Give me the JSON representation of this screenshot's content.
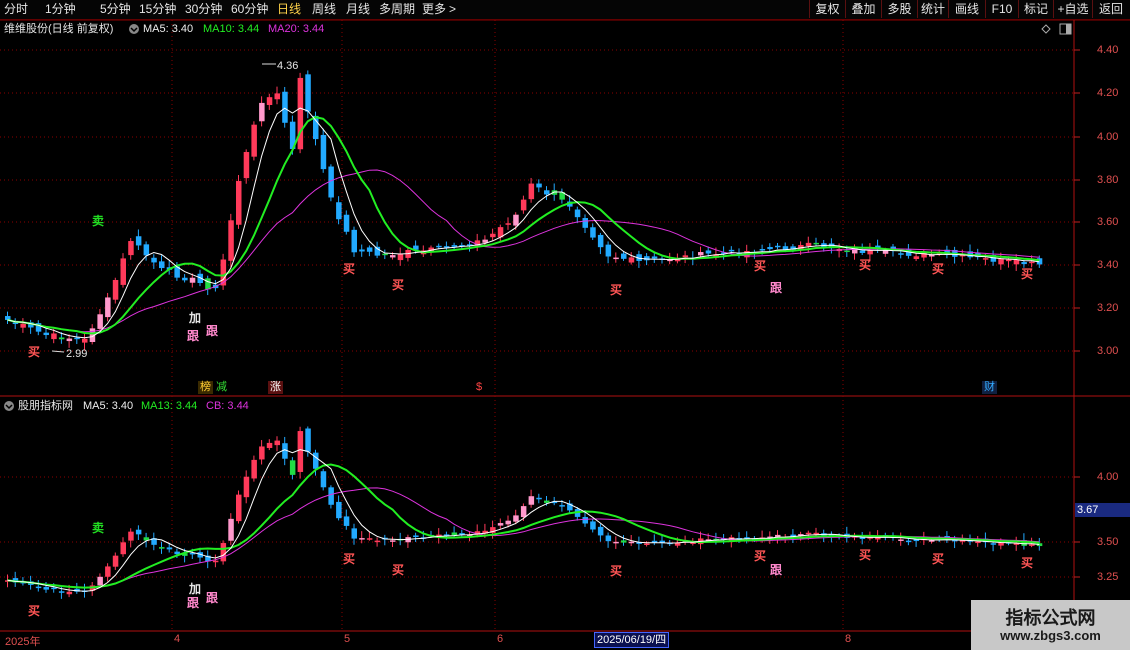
{
  "toolbar": {
    "timeframes": [
      "分时",
      "1分钟",
      "5分钟",
      "15分钟",
      "30分钟",
      "60分钟",
      "日线",
      "周线",
      "月线",
      "多周期",
      "更多"
    ],
    "active_timeframe": "日线",
    "more_chevron": ">",
    "right_buttons": [
      "复权",
      "叠加",
      "多股",
      "统计",
      "画线",
      "F10",
      "标记",
      "+自选",
      "返回"
    ]
  },
  "main_panel": {
    "title": "维维股份(日线 前复权)",
    "ma5_label": "MA5: 3.40",
    "ma10_label": "MA10: 3.44",
    "ma20_label": "MA20: 3.44",
    "price_high_label": "4.36",
    "price_low_label": "2.99",
    "y_labels": [
      "4.40",
      "4.20",
      "4.00",
      "3.80",
      "3.60",
      "3.40",
      "3.20",
      "3.00"
    ],
    "event_tags": [
      "榜",
      "减",
      "涨",
      "$",
      "财"
    ]
  },
  "sub_panel": {
    "title": "股朋指标网",
    "ma5_label": "MA5: 3.40",
    "ma13_label": "MA13: 3.44",
    "cb_label": "CB: 3.44",
    "y_labels": [
      "4.00",
      "3.50",
      "3.25"
    ],
    "current_value": "3.67"
  },
  "signals": {
    "buy": "买",
    "sell": "卖",
    "add": "加",
    "follow": "跟"
  },
  "x_axis": {
    "labels": [
      "2025年",
      "4",
      "5",
      "6",
      "8"
    ],
    "cursor_date": "2025/06/19/四"
  },
  "watermark": {
    "title": "指标公式网",
    "url": "www.zbgs3.com"
  },
  "icons": {
    "collapse": "collapse-circle-icon",
    "diamond": "diamond-icon",
    "panel": "panel-toggle-icon"
  },
  "colors": {
    "up": "#ff3a5a",
    "down": "#22aaff",
    "ma5": "#ffffff",
    "ma10": "#22ee22",
    "ma20": "#dd33dd",
    "grid": "#8b0000",
    "signal_buy": "#ff5555",
    "signal_sell": "#22dd22"
  }
}
